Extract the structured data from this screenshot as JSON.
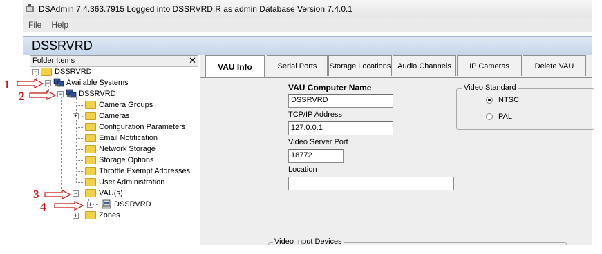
{
  "window": {
    "title": "DSAdmin 7.4.363.7915  Logged into DSSRVRD.R as admin  Database Version 7.4.0.1"
  },
  "menu": {
    "file": "File",
    "help": "Help"
  },
  "header": {
    "title": "DSSRVRD"
  },
  "sidebar": {
    "title": "Folder Items",
    "close": "✕",
    "root": "DSSRVRD",
    "available_systems": "Available Systems",
    "system": "DSSRVRD",
    "items": [
      "Camera Groups",
      "Cameras",
      "Configuration Parameters",
      "Email Notification",
      "Network Storage",
      "Storage Options",
      "Throttle Exempt Addresses",
      "User Administration"
    ],
    "vaus": "VAU(s)",
    "vau_child": "DSSRVRD",
    "zones": "Zones"
  },
  "markers": [
    "1",
    "2",
    "3",
    "4"
  ],
  "tabs": [
    "VAU Info",
    "Serial Ports",
    "Storage Locations",
    "Audio Channels",
    "IP Cameras",
    "Delete VAU"
  ],
  "form": {
    "computer_name_label": "VAU Computer Name",
    "computer_name_value": "DSSRVRD",
    "tcpip_label": "TCP/IP Address",
    "tcpip_value": "127.0.0.1",
    "port_label": "Video Server Port",
    "port_value": "18772",
    "location_label": "Location",
    "location_value": ""
  },
  "video_standard": {
    "title": "Video Standard",
    "options": [
      "NTSC",
      "PAL"
    ],
    "selected": "NTSC"
  },
  "video_input": {
    "title": "Video Input Devices"
  }
}
